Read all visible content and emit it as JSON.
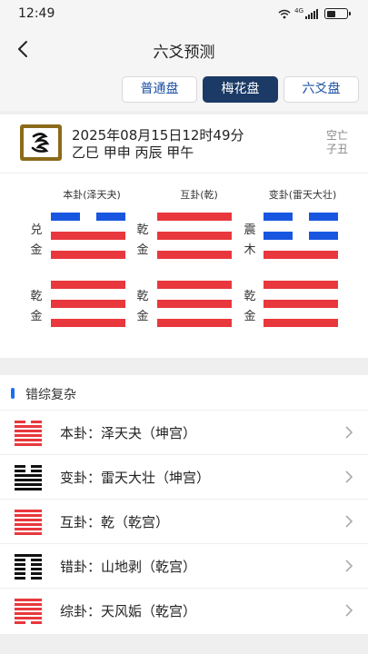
{
  "status": {
    "time": "12:49",
    "network": "4G"
  },
  "nav": {
    "title": "六爻预测"
  },
  "modes": [
    {
      "label": "普通盘",
      "active": false
    },
    {
      "label": "梅花盘",
      "active": true
    },
    {
      "label": "六爻盘",
      "active": false
    }
  ],
  "info": {
    "date": "2025年08月15日12时49分",
    "ganzhi": "乙巳 甲申 丙辰 甲午",
    "kongwang_label": "空亡",
    "kongwang_value": "子丑"
  },
  "hexagrams": [
    {
      "title": "本卦(泽天夬)",
      "upper": [
        "兑",
        "金"
      ],
      "lower": [
        "乾",
        "金"
      ],
      "lines": [
        0,
        1,
        1,
        1,
        1,
        1
      ],
      "moving": [
        0
      ]
    },
    {
      "title": "互卦(乾)",
      "upper": [
        "乾",
        "金"
      ],
      "lower": [
        "乾",
        "金"
      ],
      "lines": [
        1,
        1,
        1,
        1,
        1,
        1
      ],
      "moving": []
    },
    {
      "title": "变卦(雷天大壮)",
      "upper": [
        "震",
        "木"
      ],
      "lower": [
        "乾",
        "金"
      ],
      "lines": [
        0,
        0,
        1,
        1,
        1,
        1
      ],
      "moving": [
        0,
        1
      ]
    }
  ],
  "section": {
    "title": "错综复杂"
  },
  "relations": [
    {
      "label": "本卦：泽天夬（坤宫）",
      "icon_color": "#e8383d",
      "lines": [
        0,
        1,
        1,
        1,
        1,
        1
      ]
    },
    {
      "label": "变卦：雷天大壮（坤宫）",
      "icon_color": "#111111",
      "lines": [
        0,
        0,
        1,
        1,
        1,
        1
      ]
    },
    {
      "label": "互卦：乾（乾宫）",
      "icon_color": "#e8383d",
      "lines": [
        1,
        1,
        1,
        1,
        1,
        1
      ]
    },
    {
      "label": "错卦：山地剥（乾宫）",
      "icon_color": "#111111",
      "lines": [
        1,
        0,
        0,
        0,
        0,
        0
      ]
    },
    {
      "label": "综卦：天风姤（乾宫）",
      "icon_color": "#e8383d",
      "lines": [
        1,
        1,
        1,
        1,
        1,
        0
      ]
    }
  ],
  "colors": {
    "accent": "#1b3a66",
    "yang": "#e8383d",
    "moving": "#1856e0",
    "link": "#1a4fa3"
  }
}
